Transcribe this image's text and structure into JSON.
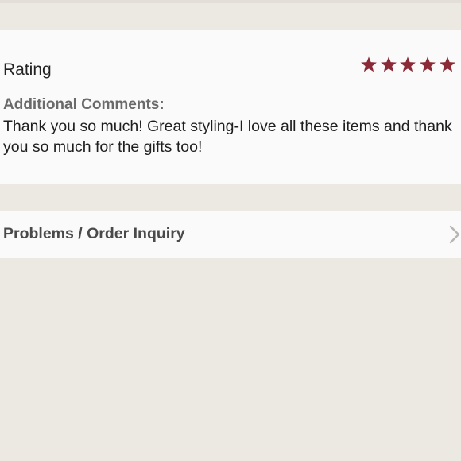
{
  "review": {
    "rating_label": "Rating",
    "rating_value": 5,
    "rating_max": 5,
    "star_color": "#8b2a37",
    "star_icon": "star-icon",
    "comments_label": "Additional Comments:",
    "comments_text": "Thank you so much! Great styling-I love all these items and thank you so much for the gifts too!"
  },
  "inquiry": {
    "label": "Problems / Order Inquiry",
    "icon": "chevron-right-icon"
  }
}
